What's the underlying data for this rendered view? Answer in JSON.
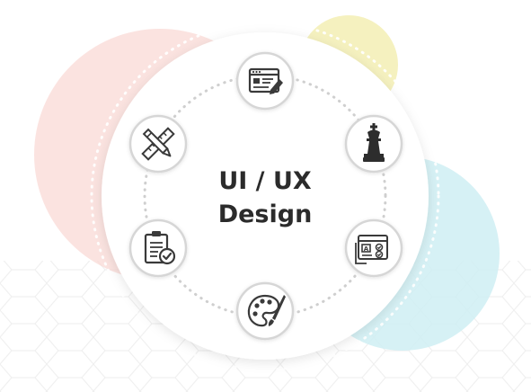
{
  "diagram": {
    "title_line_1": "UI / UX",
    "title_line_2": "Design",
    "colors": {
      "blob_pink": "#f9d9d6",
      "blob_yellow": "#f3eeb4",
      "blob_cyan": "#cfeef3",
      "hexagon_pattern": "#eeeeee",
      "main_circle": "#ffffff",
      "orbit_dots": "#cfcfcf",
      "icon_ring": "#d6d6d6",
      "icon_dark": "#3a3a3a",
      "icon_accent": "#2d2d2d"
    },
    "nodes": [
      {
        "icon": "web-design-icon"
      },
      {
        "icon": "chess-strategy-icon"
      },
      {
        "icon": "wireframe-checklist-icon"
      },
      {
        "icon": "palette-brush-icon"
      },
      {
        "icon": "clipboard-check-icon"
      },
      {
        "icon": "pencil-ruler-icon"
      }
    ]
  }
}
